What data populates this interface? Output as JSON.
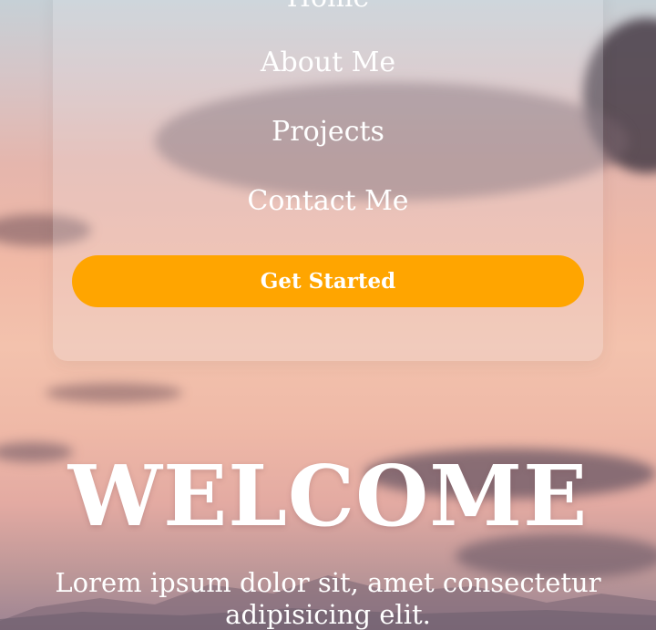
{
  "nav": {
    "items": [
      {
        "label": "Home"
      },
      {
        "label": "About Me"
      },
      {
        "label": "Projects"
      },
      {
        "label": "Contact Me"
      }
    ],
    "cta_label": "Get Started"
  },
  "hero": {
    "title": "WELCOME",
    "subtitle": "Lorem ipsum dolor sit, amet consectetur adipisicing elit."
  },
  "colors": {
    "accent": "#ffa500",
    "text": "#ffffff"
  }
}
